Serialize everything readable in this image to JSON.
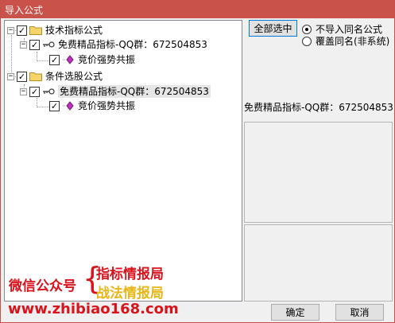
{
  "window": {
    "title": "导入公式"
  },
  "tree": {
    "groups": [
      {
        "label": "技术指标公式",
        "checked": true,
        "formula": {
          "label": "免费精品指标-QQ群：672504853",
          "checked": true,
          "item": {
            "label": "竞价强势共振",
            "checked": true
          }
        }
      },
      {
        "label": "条件选股公式",
        "checked": true,
        "formula": {
          "label": "免费精品指标-QQ群：672504853",
          "checked": true,
          "item": {
            "label": "竞价强势共振",
            "checked": true
          }
        }
      }
    ]
  },
  "options": {
    "select_all_label": "全部选中",
    "radio_options": [
      {
        "label": "不导入同名公式",
        "selected": true
      },
      {
        "label": "覆盖同名(非系统)",
        "selected": false
      }
    ]
  },
  "info": {
    "formula_name": "免费精品指标-QQ群：672504853"
  },
  "watermark": {
    "line_left": "微信公众号",
    "line_top": "指标情报局",
    "line_bottom": "战法情报局",
    "url": "www.zhibiao168.com"
  },
  "footer": {
    "ok_label": "确定",
    "cancel_label": "取消"
  },
  "colors": {
    "title_bar": "#c9524b",
    "watermark_red": "#d7141d",
    "watermark_gold": "#e8b717"
  }
}
